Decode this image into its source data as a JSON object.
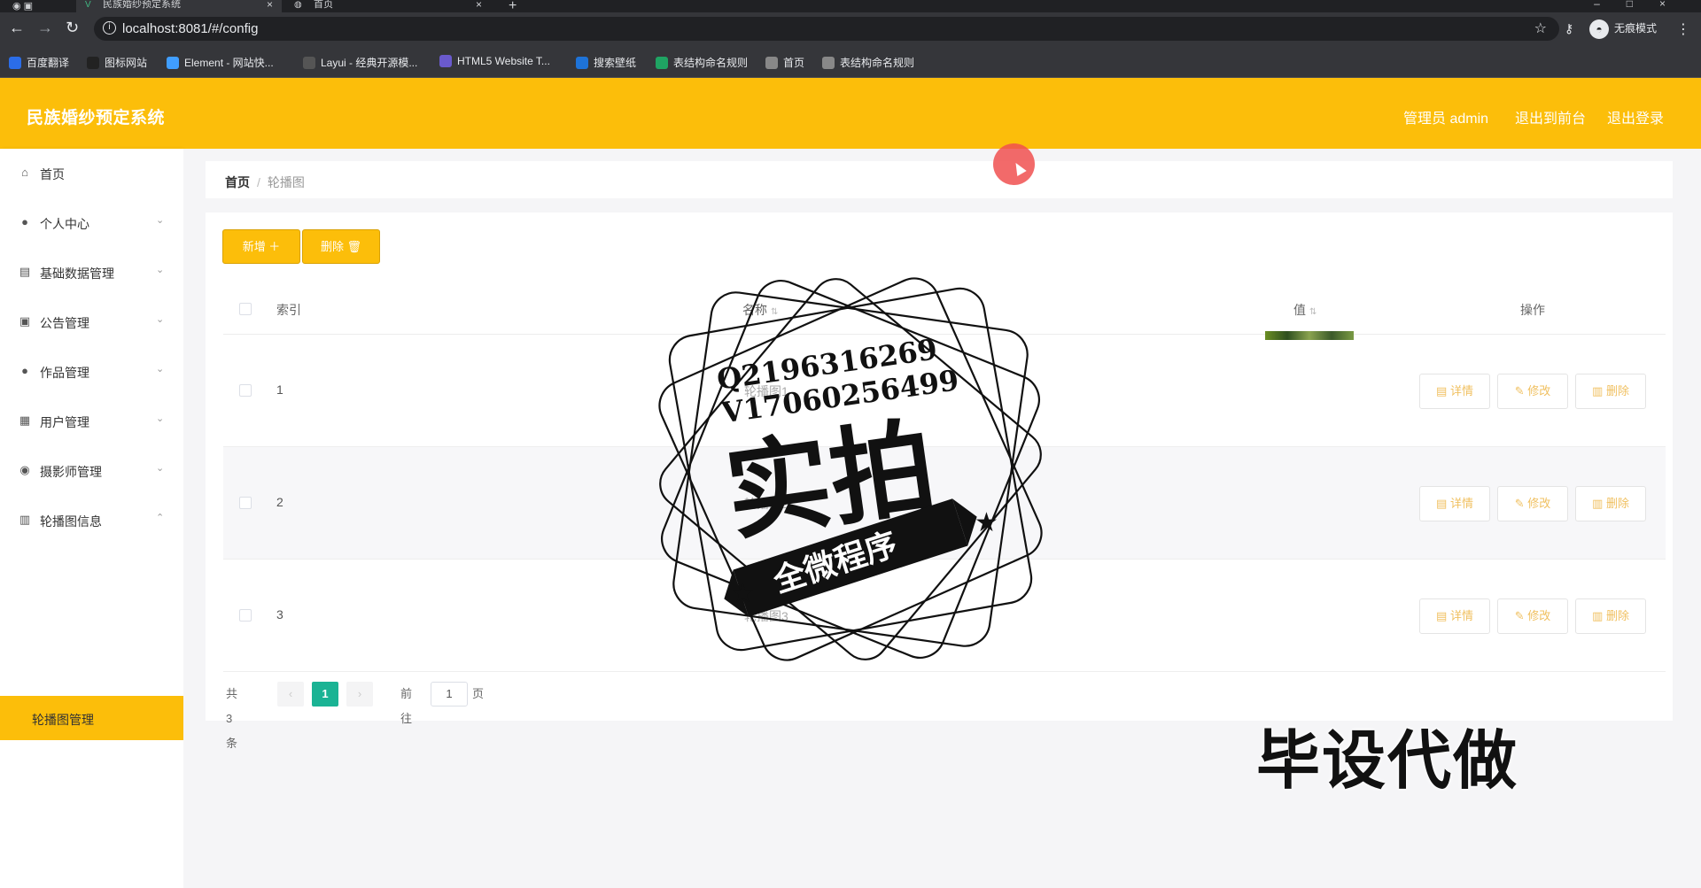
{
  "browser": {
    "active_tab_title": "民族婚纱预定系统",
    "inactive_tab_title": "首页",
    "new_tab": "+",
    "url": "localhost:8081/#/config",
    "incognito_label": "无痕模式",
    "bookmarks": [
      {
        "label": "百度翻译",
        "color": "#2b6de8"
      },
      {
        "label": "图标网站",
        "color": "#222222"
      },
      {
        "label": "Element - 网站快...",
        "color": "#409eff"
      },
      {
        "label": "Layui - 经典开源模...",
        "color": "#555555"
      },
      {
        "label": "HTML5 Website T...",
        "color": "#6a5acd"
      },
      {
        "label": "搜索壁纸",
        "color": "#1e73d8"
      },
      {
        "label": "表结构命名规则",
        "color": "#1fa463"
      },
      {
        "label": "首页",
        "color": "#888888"
      },
      {
        "label": "表结构命名规则",
        "color": "#888888"
      }
    ]
  },
  "header": {
    "title": "民族婚纱预定系统",
    "admin_label": "管理员 admin",
    "to_front_label": "退出到前台",
    "logout_label": "退出登录",
    "accent_color": "#fcbe0a"
  },
  "sidebar": {
    "items": [
      {
        "label": "首页",
        "icon": "home-icon",
        "has_chevron": false
      },
      {
        "label": "个人中心",
        "icon": "user-icon",
        "has_chevron": true
      },
      {
        "label": "基础数据管理",
        "icon": "data-icon",
        "has_chevron": true
      },
      {
        "label": "公告管理",
        "icon": "notice-icon",
        "has_chevron": true
      },
      {
        "label": "作品管理",
        "icon": "user-icon",
        "has_chevron": true
      },
      {
        "label": "用户管理",
        "icon": "users-icon",
        "has_chevron": true
      },
      {
        "label": "摄影师管理",
        "icon": "photographer-icon",
        "has_chevron": true
      },
      {
        "label": "轮播图信息",
        "icon": "carousel-icon",
        "has_chevron": true,
        "expanded": true
      }
    ],
    "active_sub_item": "轮播图管理"
  },
  "breadcrumb": {
    "home": "首页",
    "separator": "/",
    "current": "轮播图"
  },
  "toolbar": {
    "add_label": "新增 ＋",
    "delete_label": "删除 🗑"
  },
  "table": {
    "headers": {
      "index": "索引",
      "name": "名称",
      "value": "值",
      "actions": "操作"
    },
    "rows": [
      {
        "index": "1",
        "name": "轮播图1"
      },
      {
        "index": "2",
        "name": "轮播图2"
      },
      {
        "index": "3",
        "name": "轮播图3"
      }
    ],
    "row_actions": {
      "detail": "详情",
      "edit": "修改",
      "delete": "删除"
    }
  },
  "pagination": {
    "total": "共 3 条",
    "prev": "‹",
    "current_page": "1",
    "next": "›",
    "goto_prefix": "前往",
    "goto_value": "1",
    "goto_suffix": "页",
    "active_color": "#1ab394"
  },
  "overlay": {
    "qq": "Q2196316269",
    "vx": "V17060256499",
    "stamp_main": "实拍",
    "stamp_ribbon": "全微程序",
    "bottom_text": "毕设代做"
  }
}
